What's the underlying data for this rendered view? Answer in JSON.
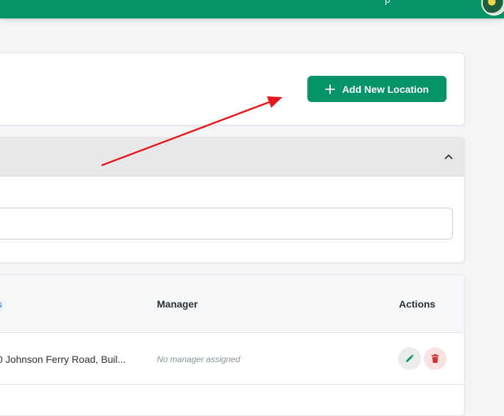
{
  "topbar": {
    "nav_fragment": "p",
    "accent_color": "#07936a"
  },
  "header": {
    "add_button_label": "Add New Location"
  },
  "filter": {
    "search_placeholder": ""
  },
  "table": {
    "columns": {
      "first_fragment": "s",
      "manager": "Manager",
      "actions": "Actions"
    },
    "rows": [
      {
        "address": "0 Johnson Ferry Road, Buil...",
        "manager": "No manager assigned"
      }
    ]
  },
  "icons": {
    "add": "plus-icon",
    "collapse": "chevron-up-icon",
    "edit": "pencil-icon",
    "delete": "trash-icon"
  },
  "colors": {
    "primary": "#07936a",
    "danger": "#d32f2f",
    "annotation": "#e8161b"
  }
}
